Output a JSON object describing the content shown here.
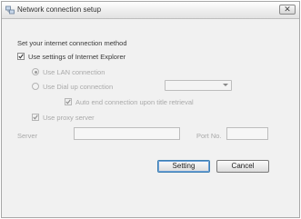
{
  "window": {
    "title": "Network connection setup",
    "close_label": "✕"
  },
  "main": {
    "instruction": "Set your internet connection method",
    "use_ie_settings": {
      "label": "Use settings of Internet Explorer",
      "checked": true
    },
    "lan_option": {
      "label": "Use LAN connection",
      "selected": true,
      "enabled": false
    },
    "dialup_option": {
      "label": "Use Dial up connection",
      "selected": false,
      "enabled": false
    },
    "dialup_select": {
      "value": ""
    },
    "auto_end": {
      "label": "Auto end connection upon title retrieval",
      "checked": true,
      "enabled": false
    },
    "proxy": {
      "label": "Use proxy server",
      "checked": true,
      "enabled": false
    },
    "server": {
      "label": "Server",
      "value": ""
    },
    "port": {
      "label": "Port No.",
      "value": ""
    }
  },
  "buttons": {
    "setting": "Setting",
    "cancel": "Cancel"
  }
}
